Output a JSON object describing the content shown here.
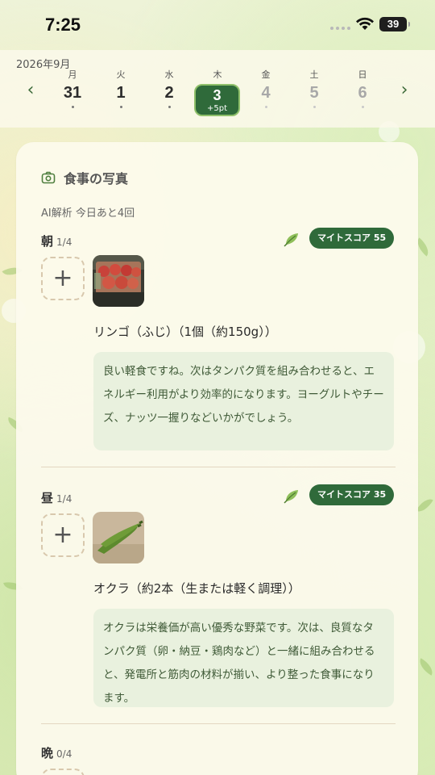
{
  "status_bar": {
    "time": "7:25",
    "battery": "39"
  },
  "calendar": {
    "month_label": "2026年9月",
    "days": [
      {
        "dow": "月",
        "num": "31"
      },
      {
        "dow": "火",
        "num": "1"
      },
      {
        "dow": "水",
        "num": "2"
      },
      {
        "dow": "木",
        "num": "3",
        "points": "+5pt"
      },
      {
        "dow": "金",
        "num": "4"
      },
      {
        "dow": "土",
        "num": "5"
      },
      {
        "dow": "日",
        "num": "6"
      }
    ],
    "prev_icon": "chevron-left-icon",
    "next_icon": "chevron-right-icon"
  },
  "card": {
    "title": "食事の写真",
    "ai_info": "AI解析 今日あと4回",
    "icon": "camera-icon"
  },
  "meals": [
    {
      "label": "朝",
      "count": "1/4",
      "score": "マイトスコア 55",
      "food_name": "リンゴ（ふじ）（1個（約150g））",
      "comment": "良い軽食ですね。次はタンパク質を組み合わせると、エネルギー利用がより効率的になります。ヨーグルトやチーズ、ナッツ一握りなどいかがでしょう。"
    },
    {
      "label": "昼",
      "count": "1/4",
      "score": "マイトスコア 35",
      "food_name": "オクラ（約2本（生または軽く調理））",
      "comment": "オクラは栄養価が高い優秀な野菜です。次は、良質なタンパク質（卵・納豆・鶏肉など）と一緒に組み合わせると、発電所と筋肉の材料が揃い、より整った食事になります。"
    },
    {
      "label": "晩",
      "count": "0/4"
    }
  ],
  "colors": {
    "accent_green": "#2f6a3a",
    "comment_bg": "#e9f1de"
  }
}
